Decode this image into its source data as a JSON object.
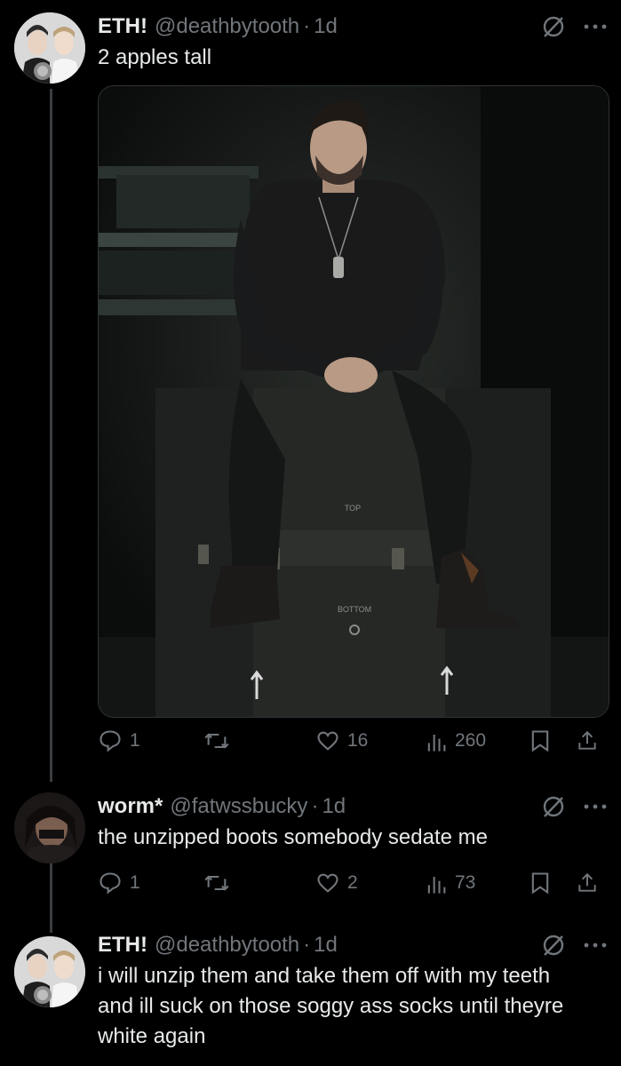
{
  "tweets": [
    {
      "name": "ETH!",
      "handle": "@deathbytooth",
      "time": "1d",
      "text": "2 apples tall",
      "replies": "1",
      "likes": "16",
      "views": "260"
    },
    {
      "name": "worm*",
      "handle": "@fatwssbucky",
      "time": "1d",
      "text": "the unzipped boots somebody sedate me",
      "replies": "1",
      "likes": "2",
      "views": "73"
    },
    {
      "name": "ETH!",
      "handle": "@deathbytooth",
      "time": "1d",
      "text": "i will unzip them and take them off with my teeth and ill suck on those soggy ass socks until theyre white again"
    }
  ],
  "media": {
    "case_label_top": "TOP",
    "case_label_bottom": "BOTTOM"
  },
  "icons": {
    "reply": "reply-icon",
    "retweet": "retweet-icon",
    "like": "heart-icon",
    "views": "views-icon",
    "bookmark": "bookmark-icon",
    "share": "share-icon",
    "grok": "grok-icon",
    "more": "more-icon"
  },
  "colors": {
    "background": "#000000",
    "text": "#e7e9ea",
    "secondary": "#71767b",
    "thread_line": "#3a3d40"
  }
}
